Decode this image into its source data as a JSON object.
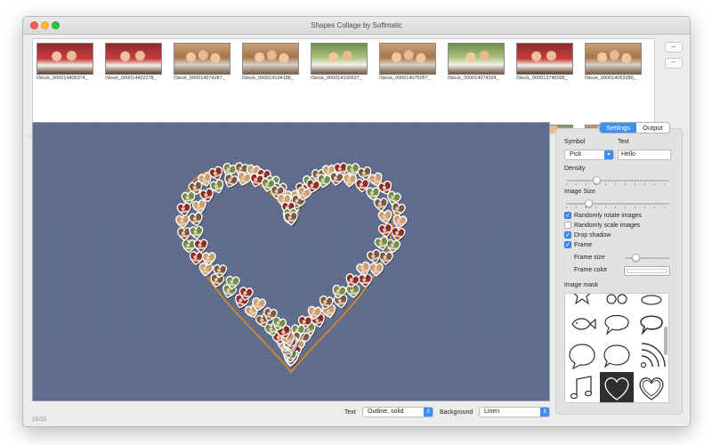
{
  "window": {
    "title": "Shapes Collage by Softmatic"
  },
  "browser": {
    "captions": [
      "iStock_000014406374_",
      "iStock_000014402278_",
      "iStock_000014074287_",
      "iStock_000014104188_",
      "iStock_000014100637_",
      "iStock_000014075057_",
      "iStock_000014074324_",
      "iStock_000013745095_",
      "iStock_000014053390_"
    ],
    "buttons": [
      "–",
      "--"
    ]
  },
  "tabs": {
    "settings": "Settings",
    "output": "Output"
  },
  "settings": {
    "symbol_label": "Symbol",
    "symbol_value": "Pick",
    "text_label": "Text",
    "text_value": "Hello",
    "density_label": "Density",
    "density_level": 0.28,
    "image_size_label": "Image Size",
    "image_size_level": 0.2,
    "options": [
      {
        "label": "Randomly rotate images",
        "checked": true
      },
      {
        "label": "Randomly scale images",
        "checked": false
      },
      {
        "label": "Drop shadow",
        "checked": true
      },
      {
        "label": "Frame",
        "checked": true
      }
    ],
    "frame_size_label": "Frame size",
    "frame_size_level": 0.2,
    "frame_color_label": "Frame color",
    "frame_color": "#ffffff",
    "image_mask_label": "Image mask",
    "mask_icons": [
      "star-icon",
      "ring-icon",
      "loop-icon",
      "fish-icon",
      "speech-bubble-icon",
      "speech-bubble-outline-icon",
      "round-bubble-icon",
      "cloud-bubble-icon",
      "rss-icon",
      "music-note-icon",
      "heart-filled-icon",
      "heart-outline-icon"
    ],
    "selected_mask": "heart-filled-icon"
  },
  "bottom": {
    "text_label": "Text",
    "text_value": "Outline, solid",
    "background_label": "Background",
    "background_value": "Linen"
  },
  "status": "25/25",
  "colors": {
    "accent": "#3d8ef6",
    "canvas_background": "#5f6c8b",
    "outline": "#e08a1e"
  }
}
